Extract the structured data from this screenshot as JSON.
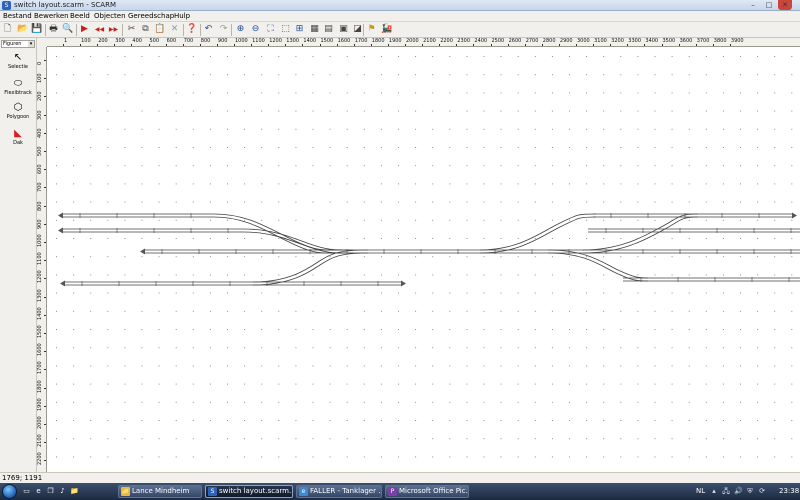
{
  "window": {
    "title": "switch layout.scarm - SCARM",
    "app_icon": "scarm-icon",
    "controls": {
      "minimize": "–",
      "maximize": "□",
      "close": "✕"
    }
  },
  "menu": [
    "Bestand",
    "Bewerken",
    "Beeld",
    "Objecten",
    "Gereedschap",
    "Hulp"
  ],
  "toolbar_icons": [
    {
      "name": "new-file-icon",
      "glyph": "🗋",
      "color": "#333"
    },
    {
      "name": "open-folder-icon",
      "glyph": "📂",
      "color": "#c79a1d"
    },
    {
      "name": "save-icon",
      "glyph": "💾",
      "color": "#2a4f8f"
    },
    {
      "name": "print-icon",
      "glyph": "🖶",
      "color": "#333"
    },
    {
      "name": "print-preview-icon",
      "glyph": "🔍",
      "color": "#333"
    },
    {
      "name": "play-icon",
      "glyph": "▶",
      "color": "#c81e1e"
    },
    {
      "name": "rewind-icon",
      "glyph": "◀◀",
      "color": "#c81e1e"
    },
    {
      "name": "fast-forward-icon",
      "glyph": "▶▶",
      "color": "#c81e1e"
    },
    {
      "name": "cut-icon",
      "glyph": "✂",
      "color": "#444"
    },
    {
      "name": "copy-icon",
      "glyph": "⧉",
      "color": "#444"
    },
    {
      "name": "paste-icon",
      "glyph": "📋",
      "color": "#a57a2c"
    },
    {
      "name": "delete-icon",
      "glyph": "✕",
      "color": "#999"
    },
    {
      "name": "help-icon",
      "glyph": "❓",
      "color": "#1f4fa0"
    },
    {
      "name": "undo-icon",
      "glyph": "↶",
      "color": "#1f4fa0"
    },
    {
      "name": "redo-icon",
      "glyph": "↷",
      "color": "#999"
    },
    {
      "name": "zoom-in-icon",
      "glyph": "⊕",
      "color": "#1f4fa0"
    },
    {
      "name": "zoom-out-icon",
      "glyph": "⊖",
      "color": "#1f4fa0"
    },
    {
      "name": "zoom-fit-icon",
      "glyph": "⛶",
      "color": "#1f4fa0"
    },
    {
      "name": "zoom-window-icon",
      "glyph": "⬚",
      "color": "#1f4fa0"
    },
    {
      "name": "grid-icon",
      "glyph": "⊞",
      "color": "#1f4fa0"
    },
    {
      "name": "ruler-icon",
      "glyph": "▦",
      "color": "#444"
    },
    {
      "name": "layers-icon",
      "glyph": "▤",
      "color": "#444"
    },
    {
      "name": "properties-icon",
      "glyph": "▣",
      "color": "#444"
    },
    {
      "name": "toggle-icon",
      "glyph": "◪",
      "color": "#444"
    },
    {
      "name": "flag-icon",
      "glyph": "⚑",
      "color": "#c79a1d"
    },
    {
      "name": "train-3d-icon",
      "glyph": "🚂",
      "color": "#1e8a2a"
    }
  ],
  "left_panel": {
    "dropdown": "Figuren",
    "tools": [
      {
        "name": "select-tool",
        "icon": "cursor-arrow-icon",
        "glyph": "↖",
        "label": "Selectie"
      },
      {
        "name": "flexible-track-tool",
        "icon": "flex-track-icon",
        "glyph": "⬭",
        "label": "Flexibtrack"
      },
      {
        "name": "polygon-tool",
        "icon": "polygon-icon",
        "glyph": "⬡",
        "label": "Polygoon"
      },
      {
        "name": "roof-tool",
        "icon": "roof-icon",
        "glyph": "◣",
        "label": "Dak"
      }
    ]
  },
  "ruler": {
    "top_labels": [
      "1",
      "100",
      "200",
      "300",
      "400",
      "500",
      "600",
      "700",
      "800",
      "900",
      "1000",
      "1100",
      "1200",
      "1300",
      "1400",
      "1500",
      "1600",
      "1700",
      "1800",
      "1900",
      "2000",
      "2100",
      "2200",
      "2300",
      "2400",
      "2500",
      "2600",
      "2700",
      "2800",
      "2900",
      "3000",
      "3100",
      "3200",
      "3300",
      "3400",
      "3500",
      "3600",
      "3700",
      "3800",
      "3900"
    ],
    "left_labels": [
      "0",
      "100",
      "200",
      "300",
      "400",
      "500",
      "600",
      "700",
      "800",
      "900",
      "1000",
      "1100",
      "1200",
      "1300",
      "1400",
      "1500",
      "1600",
      "1700",
      "1800",
      "1900",
      "2000",
      "2100",
      "2200"
    ]
  },
  "status": {
    "coordinates": "1769; 1191"
  },
  "colors": {
    "track_rail": "#404040",
    "track_sleeper": "#5a5a5a",
    "grid_dot": "#8c8c8c",
    "selection": "#c81e1e"
  },
  "taskbar": {
    "quick_launch": [
      {
        "name": "show-desktop-icon",
        "glyph": "▭"
      },
      {
        "name": "ie-icon",
        "glyph": "e"
      },
      {
        "name": "switch-windows-icon",
        "glyph": "❐"
      },
      {
        "name": "media-icon",
        "glyph": "♪"
      },
      {
        "name": "explorer-icon",
        "glyph": "📁"
      }
    ],
    "buttons": [
      {
        "name": "taskbar-lance-mindheim",
        "label": "Lance Mindheim",
        "icon": "folder-icon",
        "glyph": "📁",
        "active": false
      },
      {
        "name": "taskbar-scarm",
        "label": "switch layout.scarm...",
        "icon": "scarm-icon",
        "glyph": "S",
        "active": true
      },
      {
        "name": "taskbar-faller",
        "label": "FALLER - Tanklager ...",
        "icon": "browser-icon",
        "glyph": "e",
        "active": false
      },
      {
        "name": "taskbar-office",
        "label": "Microsoft Office Pic...",
        "icon": "office-icon",
        "glyph": "P",
        "active": false
      }
    ],
    "tray": {
      "language": "NL",
      "icons": [
        {
          "name": "tray-up-icon",
          "glyph": "▴"
        },
        {
          "name": "network-icon",
          "glyph": "🖧"
        },
        {
          "name": "volume-icon",
          "glyph": "🔊"
        },
        {
          "name": "security-icon",
          "glyph": "⛨"
        },
        {
          "name": "update-icon",
          "glyph": "⟳"
        }
      ],
      "clock": "23:38"
    }
  }
}
